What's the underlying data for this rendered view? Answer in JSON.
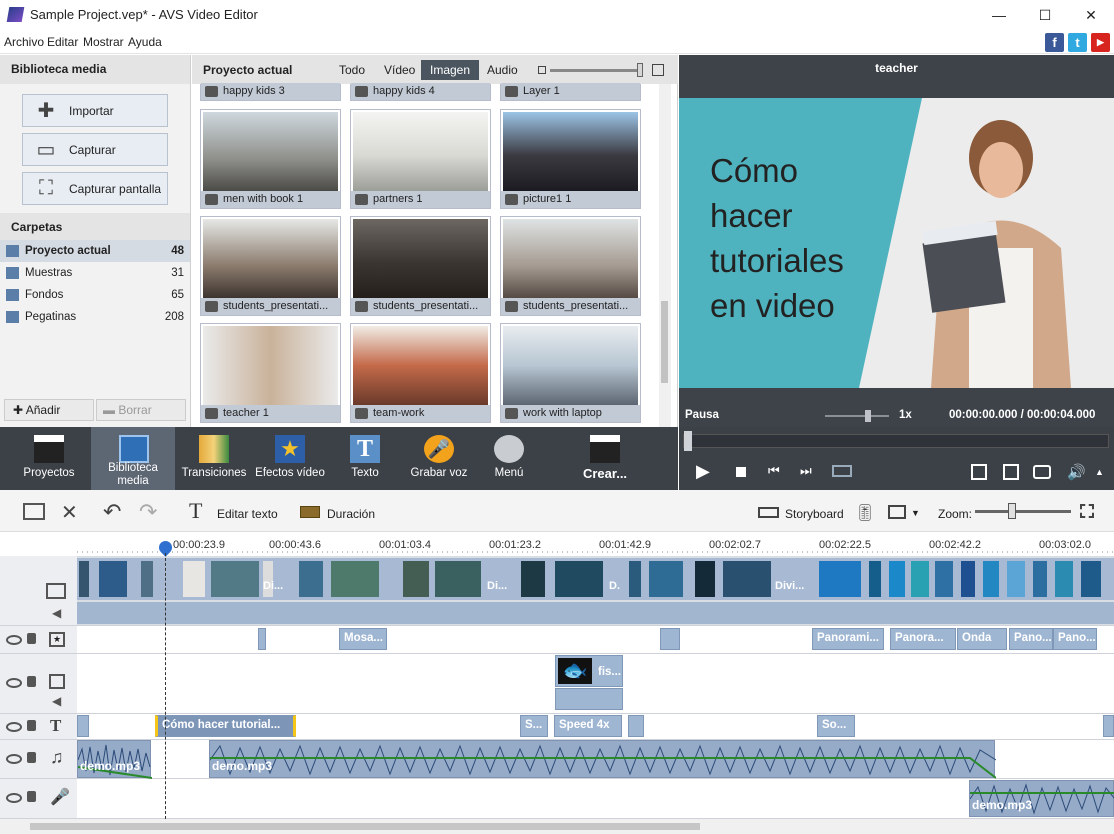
{
  "window": {
    "title": "Sample Project.vep* - AVS Video Editor",
    "minimize": "—",
    "maximize": "☐",
    "close": "✕"
  },
  "menu": [
    "Archivo",
    "Editar",
    "Mostrar",
    "Ayuda"
  ],
  "social": {
    "facebook": "f",
    "twitter": "t",
    "youtube": "▶"
  },
  "library": {
    "title": "Biblioteca media",
    "buttons": [
      {
        "label": "Importar",
        "icon": "plus-icon"
      },
      {
        "label": "Capturar",
        "icon": "camera-icon"
      },
      {
        "label": "Capturar pantalla",
        "icon": "screen-capture-icon"
      }
    ],
    "folders_title": "Carpetas",
    "folders": [
      {
        "name": "Proyecto actual",
        "count": "48"
      },
      {
        "name": "Muestras",
        "count": "31"
      },
      {
        "name": "Fondos",
        "count": "65"
      },
      {
        "name": "Pegatinas",
        "count": "208"
      }
    ],
    "add": "Añadir",
    "remove": "Borrar"
  },
  "project": {
    "title": "Proyecto actual",
    "filters": [
      "Todo",
      "Vídeo",
      "Imagen",
      "Audio"
    ],
    "active_filter": "Imagen",
    "items": [
      "happy kids 3",
      "happy kids 4",
      "Layer 1",
      "men with book 1",
      "partners 1",
      "picture1 1",
      "students_presentati...",
      "students_presentati...",
      "students_presentati...",
      "teacher 1",
      "team-work",
      "work with laptop"
    ]
  },
  "preview": {
    "title": "teacher",
    "slide_text": [
      "Cómo",
      "hacer",
      "tutoriales",
      "en video"
    ],
    "status": "Pausa",
    "speed": "1x",
    "time": "00:00:00.000 / 00:00:04.000"
  },
  "toolbar": [
    "Proyectos",
    "Biblioteca media",
    "Transiciones",
    "Efectos vídeo",
    "Texto",
    "Grabar voz",
    "Menú",
    "Crear..."
  ],
  "toolbar_active": "Biblioteca media",
  "timeline": {
    "edit_text": "Editar texto",
    "duration": "Duración",
    "storyboard": "Storyboard",
    "zoom": "Zoom:",
    "ruler": [
      "00:00:23.9",
      "00:00:43.6",
      "00:01:03.4",
      "00:01:23.2",
      "00:01:42.9",
      "00:02:02.7",
      "00:02:22.5",
      "00:02:42.2",
      "00:03:02.0"
    ],
    "effects": [
      "Mosa...",
      "Panorami...",
      "Panora...",
      "Onda",
      "Pano...",
      "Pano..."
    ],
    "overlay": "fis...",
    "text_clips": [
      "Cómo hacer tutorial...",
      "S...",
      "Speed 4x",
      "So..."
    ],
    "video_labels": [
      "Di...",
      "Di...",
      "D.",
      "Divi..."
    ],
    "music": [
      "demo.mp3",
      "demo.mp3"
    ],
    "voice": "demo.mp3"
  },
  "colors": {
    "accent": "#4b5560",
    "clip": "#9fb6d3",
    "slide_teal": "#4fb3bf",
    "text_highlight": "#f5c518"
  }
}
